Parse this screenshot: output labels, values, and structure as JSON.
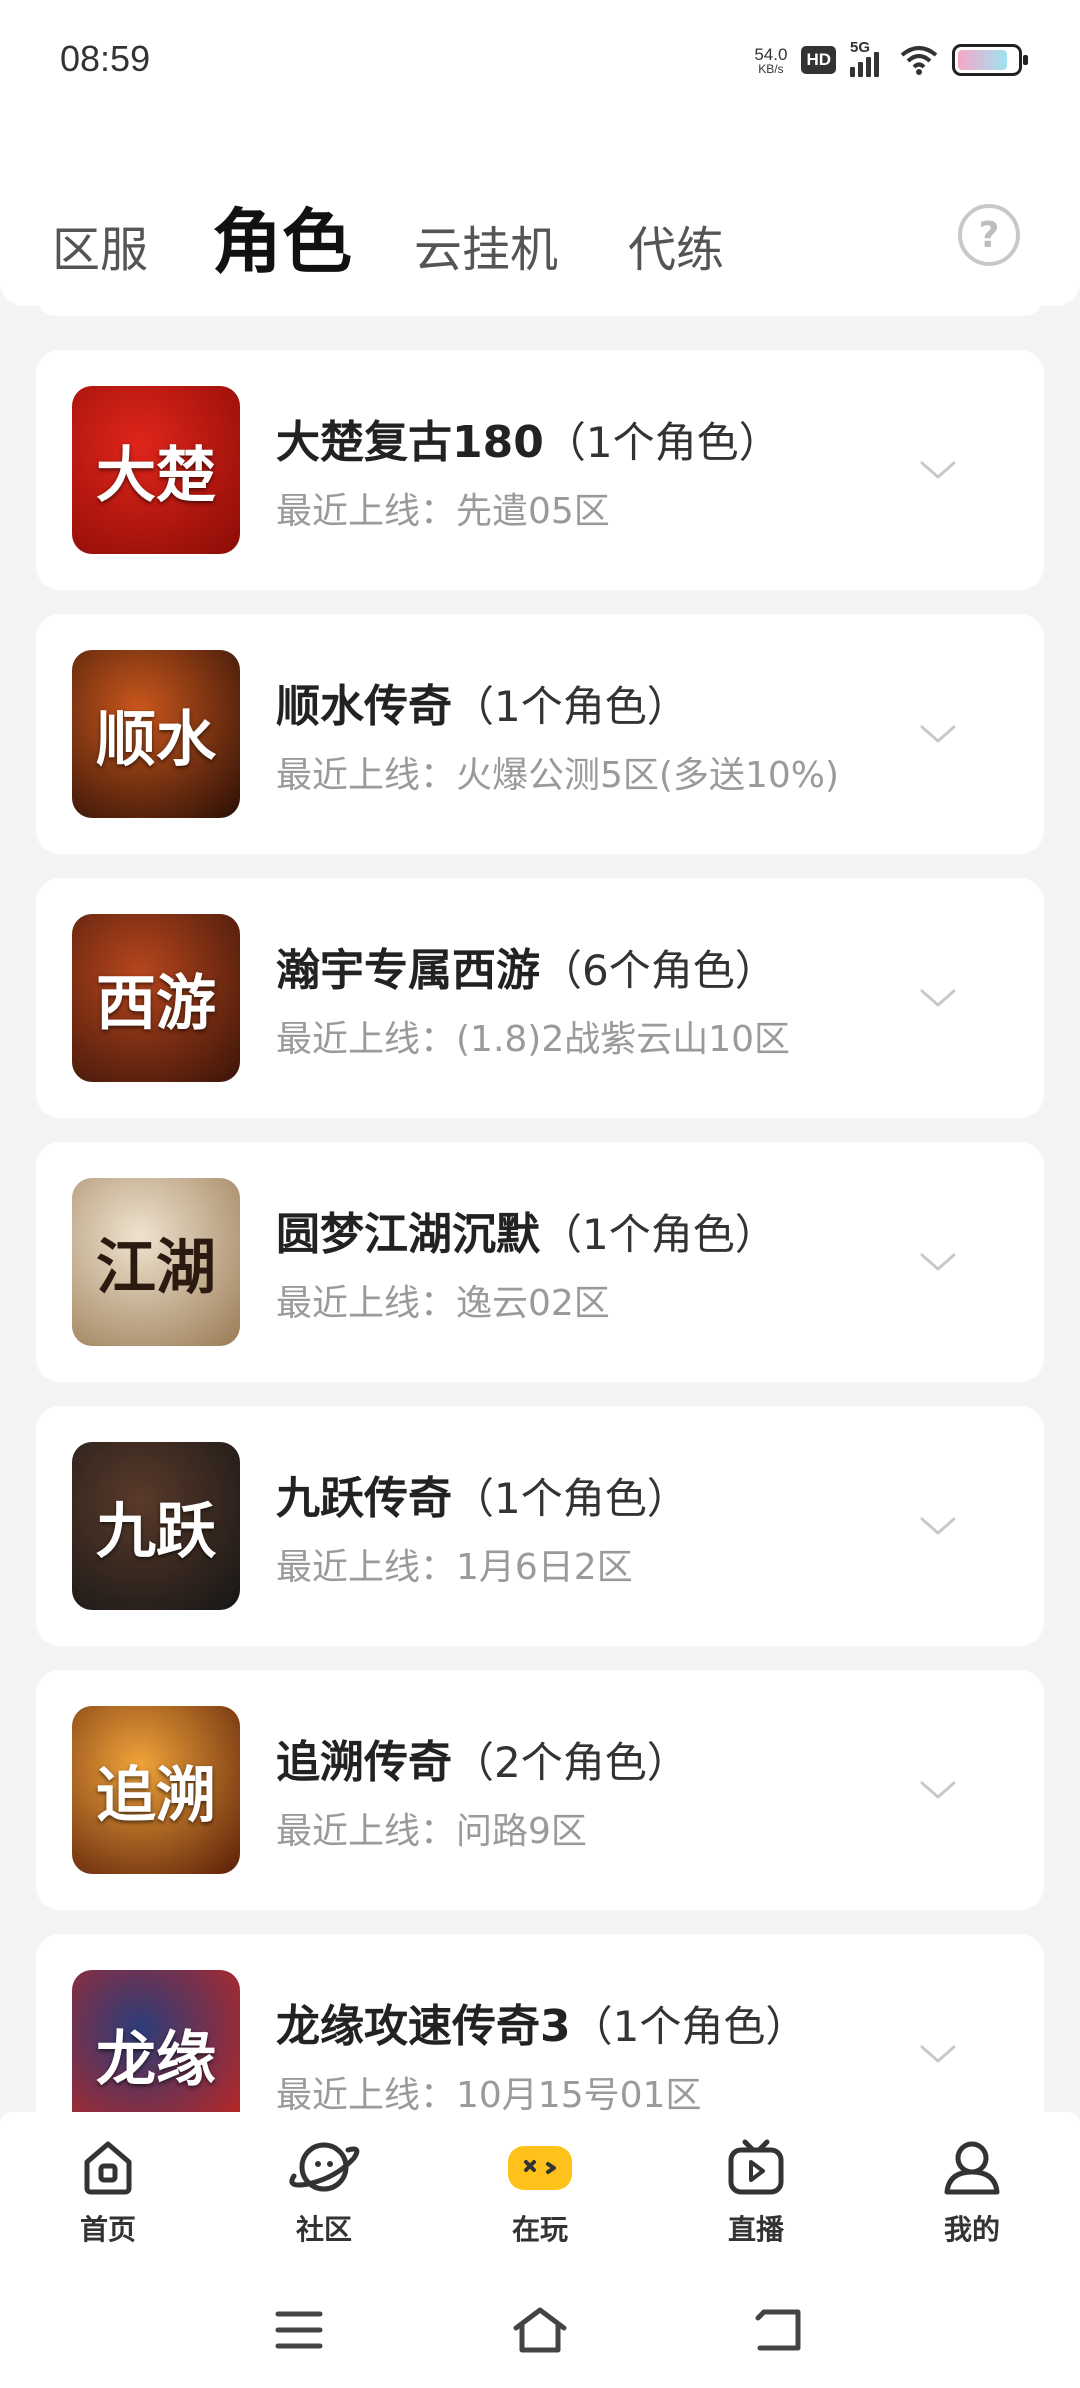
{
  "status": {
    "time": "08:59",
    "net_speed_value": "54.0",
    "net_speed_unit": "KB/s",
    "hd": "HD",
    "signal": "5G",
    "battery_level": 0.85
  },
  "tabs": [
    {
      "label": "区服",
      "active": false
    },
    {
      "label": "角色",
      "active": true
    },
    {
      "label": "云挂机",
      "active": false
    },
    {
      "label": "代练",
      "active": false
    }
  ],
  "help_icon": "question-circle-icon",
  "games": [
    {
      "name": "大楚复古180",
      "count": "（1个角色）",
      "recent": "最近上线：先遣05区",
      "icon_text": "大楚",
      "icon_colors": [
        "#e0251b",
        "#8a0c06"
      ]
    },
    {
      "name": "顺水传奇",
      "count": "（1个角色）",
      "recent": "最近上线：火爆公测5区(多送10%)",
      "icon_text": "顺水",
      "icon_colors": [
        "#c9571c",
        "#2a0f06"
      ]
    },
    {
      "name": "瀚宇专属西游",
      "count": "（6个角色）",
      "recent": "最近上线：(1.8)2战紫云山10区",
      "icon_text": "西游",
      "icon_colors": [
        "#b7461d",
        "#3a1408"
      ]
    },
    {
      "name": "圆梦江湖沉默",
      "count": "（1个角色）",
      "recent": "最近上线：逸云02区",
      "icon_text": "江湖",
      "icon_colors": [
        "#efe3cf",
        "#9a7b55"
      ]
    },
    {
      "name": "九跃传奇",
      "count": "（1个角色）",
      "recent": "最近上线：1月6日2区",
      "icon_text": "九跃",
      "icon_colors": [
        "#5a3a2a",
        "#161616"
      ]
    },
    {
      "name": "追溯传奇",
      "count": "（2个角色）",
      "recent": "最近上线：问路9区",
      "icon_text": "追溯",
      "icon_colors": [
        "#f0a43a",
        "#5a1d08"
      ]
    },
    {
      "name": "龙缘攻速传奇3",
      "count": "（1个角色）",
      "recent": "最近上线：10月15号01区",
      "icon_text": "龙缘",
      "icon_colors": [
        "#2b3d7a",
        "#c8241b"
      ]
    }
  ],
  "bottom_nav": [
    {
      "label": "首页",
      "icon": "home-icon",
      "active": false
    },
    {
      "label": "社区",
      "icon": "planet-icon",
      "active": false
    },
    {
      "label": "在玩",
      "icon": "gamepad-icon",
      "active": true
    },
    {
      "label": "直播",
      "icon": "tv-play-icon",
      "active": false
    },
    {
      "label": "我的",
      "icon": "user-icon",
      "active": false
    }
  ],
  "colors": {
    "accent": "#ffc21a",
    "background": "#f4f4f4",
    "card": "#ffffff",
    "subtext": "#9a9a9a"
  }
}
